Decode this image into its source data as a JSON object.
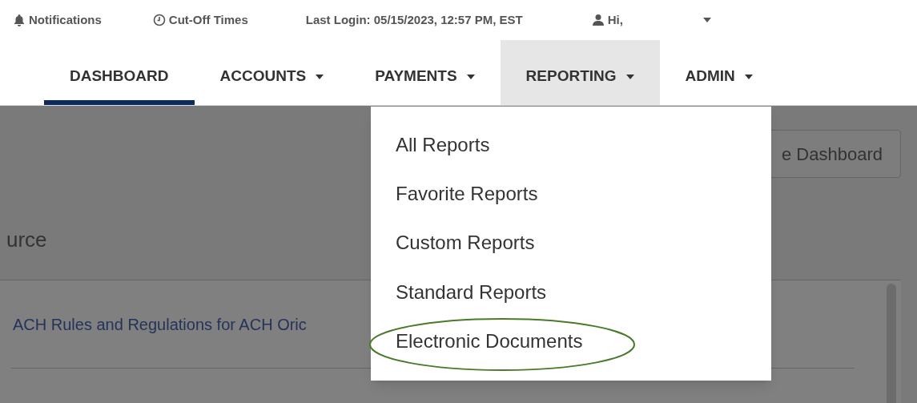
{
  "top_bar": [
    {
      "kind": "bell",
      "label": "Notifications"
    },
    {
      "kind": "clock",
      "label": "Cut-Off Times"
    },
    {
      "kind": "none",
      "label": "Last Login: 05/15/2023, 12:57 PM, EST"
    },
    {
      "kind": "user",
      "label": "Hi,"
    }
  ],
  "nav": [
    {
      "label": "DASHBOARD",
      "selected": true,
      "caret": false,
      "open": false
    },
    {
      "label": "ACCOUNTS",
      "selected": false,
      "caret": true,
      "open": false
    },
    {
      "label": "PAYMENTS",
      "selected": false,
      "caret": true,
      "open": false
    },
    {
      "label": "REPORTING",
      "selected": false,
      "caret": true,
      "open": true
    },
    {
      "label": "ADMIN",
      "selected": false,
      "caret": true,
      "open": false
    }
  ],
  "dropdown": [
    {
      "label": "All Reports",
      "circled": false
    },
    {
      "label": "Favorite Reports",
      "circled": false
    },
    {
      "label": "Custom Reports",
      "circled": false
    },
    {
      "label": "Standard Reports",
      "circled": false
    },
    {
      "label": "Electronic Documents",
      "circled": true
    }
  ],
  "dashboard_button": "e Dashboard",
  "card": {
    "title": "urce",
    "link": "ACH Rules and Regulations for ACH Oric"
  }
}
